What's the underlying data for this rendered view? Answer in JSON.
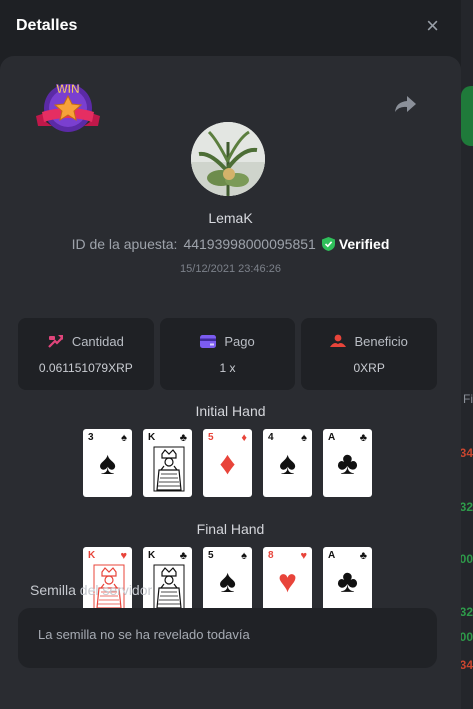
{
  "modal": {
    "title": "Detalles",
    "close_glyph": "×"
  },
  "bet": {
    "badge_text": "WIN",
    "username": "LemaK",
    "bet_id_label": "ID de la apuesta:",
    "bet_id": "44193998000095851",
    "verified_label": "Verified",
    "datetime": "15/12/2021 23:46:26"
  },
  "stats": [
    {
      "label": "Cantidad",
      "value": "0.061151079XRP",
      "icon": "amount-icon",
      "color": "#e0457b"
    },
    {
      "label": "Pago",
      "value": "1 x",
      "icon": "payout-card-icon",
      "color": "#7b5cf0"
    },
    {
      "label": "Beneficio",
      "value": "0XRP",
      "icon": "profit-icon",
      "color": "#e8443a"
    }
  ],
  "initial_hand": {
    "title": "Initial Hand",
    "cards": [
      {
        "rank": "3",
        "suit": "♠",
        "color": "black",
        "face": false
      },
      {
        "rank": "K",
        "suit": "♣",
        "color": "black",
        "face": true
      },
      {
        "rank": "5",
        "suit": "♦",
        "color": "red",
        "face": false
      },
      {
        "rank": "4",
        "suit": "♠",
        "color": "black",
        "face": false
      },
      {
        "rank": "A",
        "suit": "♣",
        "color": "black",
        "face": false
      }
    ]
  },
  "final_hand": {
    "title": "Final Hand",
    "cards": [
      {
        "rank": "K",
        "suit": "♥",
        "color": "red",
        "face": true
      },
      {
        "rank": "K",
        "suit": "♣",
        "color": "black",
        "face": true
      },
      {
        "rank": "5",
        "suit": "♠",
        "color": "black",
        "face": false
      },
      {
        "rank": "8",
        "suit": "♥",
        "color": "red",
        "face": false
      },
      {
        "rank": "A",
        "suit": "♣",
        "color": "black",
        "face": false
      }
    ]
  },
  "seed": {
    "label": "Semilla del servidor",
    "value": "La semilla no se ha revelado todavía"
  },
  "background_edge": {
    "fragments": [
      "Fi",
      "34",
      "32",
      "00",
      "32",
      "00",
      "34"
    ]
  }
}
